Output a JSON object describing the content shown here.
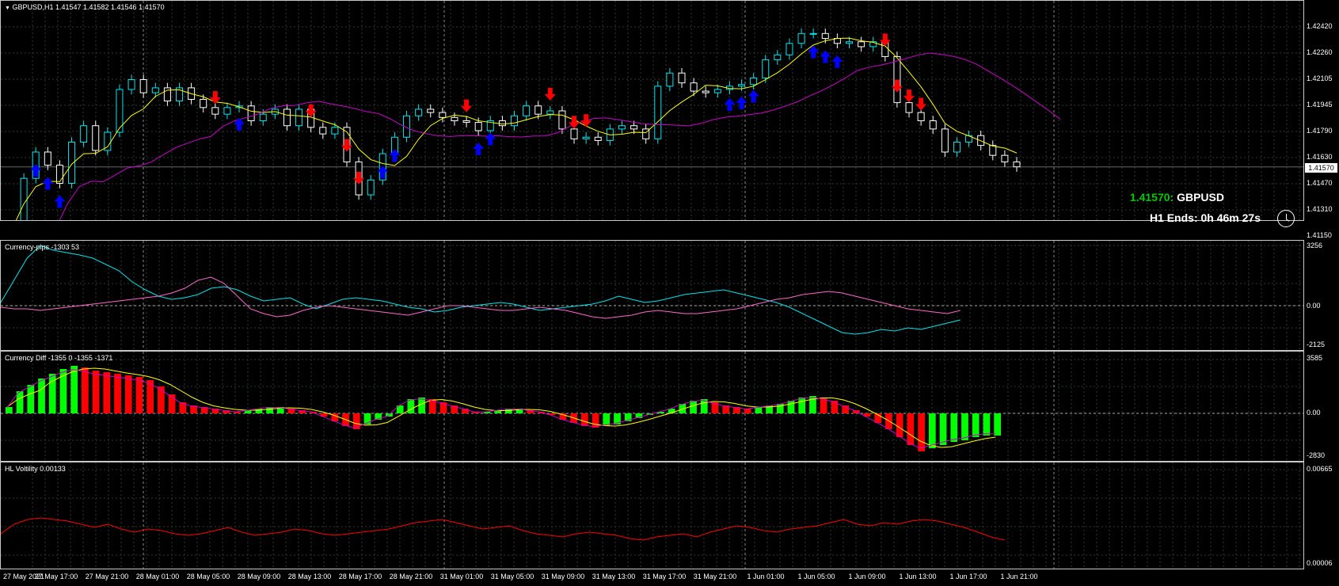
{
  "main": {
    "title": "GBPUSD,H1  1.41547 1.41582 1.41546 1.41570",
    "current_price": "1.41570",
    "price_axis": [
      "1.42420",
      "1.42260",
      "1.42105",
      "1.41945",
      "1.41790",
      "1.41630",
      "1.41470",
      "1.41310",
      "1.41150"
    ],
    "info_price": "1.41570:",
    "info_symbol": "GBPUSD",
    "info_timer": "H1 Ends: 0h 46m 27s",
    "colors": {
      "bull": "#00e5ee",
      "bear": "#ffffff",
      "ma_fast": "#ffff00",
      "ma_slow": "#cc00cc",
      "buy_arrow": "#0000ff",
      "sell_arrow": "#ff0000",
      "price_label": "#00c800"
    }
  },
  "pips": {
    "title": "Currency-pips -1303 53",
    "axis": [
      "3256",
      "0.00",
      "-2125"
    ],
    "colors": {
      "a": "#00e5ee",
      "b": "#ff66cc"
    }
  },
  "diff": {
    "title": "Currency Diff -1355 0 -1355 -1371",
    "axis": [
      "3585",
      "0.00",
      "-2830"
    ],
    "colors": {
      "up": "#00ff00",
      "down": "#ff0000",
      "signal": "#ffff00",
      "line": "#cc00cc"
    }
  },
  "hl": {
    "title": "HL Voltility 0.00133",
    "axis": [
      "0.00665",
      "0.00006"
    ],
    "color": "#ff0000"
  },
  "time_axis": [
    "27 May 2021",
    "27 May 17:00",
    "27 May 21:00",
    "28 May 01:00",
    "28 May 05:00",
    "28 May 09:00",
    "28 May 13:00",
    "28 May 17:00",
    "28 May 21:00",
    "31 May 01:00",
    "31 May 05:00",
    "31 May 09:00",
    "31 May 13:00",
    "31 May 17:00",
    "31 May 21:00",
    "1 Jun 01:00",
    "1 Jun 05:00",
    "1 Jun 09:00",
    "1 Jun 13:00",
    "1 Jun 17:00",
    "1 Jun 21:00"
  ],
  "chart_data": {
    "type": "candlestick",
    "series": [
      {
        "name": "GBPUSD,H1",
        "close": [
          1.4119,
          1.415,
          1.4166,
          1.4158,
          1.4147,
          1.4172,
          1.4182,
          1.4167,
          1.4178,
          1.4204,
          1.421,
          1.4202,
          1.4205,
          1.4197,
          1.4205,
          1.4198,
          1.4193,
          1.4189,
          1.4193,
          1.4194,
          1.4185,
          1.4189,
          1.4192,
          1.4182,
          1.4192,
          1.4181,
          1.4177,
          1.4181,
          1.416,
          1.414,
          1.4149,
          1.4165,
          1.4175,
          1.4188,
          1.4192,
          1.419,
          1.4187,
          1.4185,
          1.4184,
          1.4179,
          1.4185,
          1.4182,
          1.4188,
          1.4194,
          1.4189,
          1.4191,
          1.418,
          1.4174,
          1.4175,
          1.4173,
          1.418,
          1.4182,
          1.418,
          1.4174,
          1.4206,
          1.4214,
          1.4208,
          1.4203,
          1.4202,
          1.4204,
          1.4206,
          1.4207,
          1.4211,
          1.4222,
          1.4225,
          1.4232,
          1.4238,
          1.4238,
          1.4235,
          1.4232,
          1.4233,
          1.423,
          1.4233,
          1.4224,
          1.4196,
          1.419,
          1.4185,
          1.418,
          1.4166,
          1.4172,
          1.4176,
          1.417,
          1.4164,
          1.416,
          1.4157
        ]
      }
    ]
  }
}
